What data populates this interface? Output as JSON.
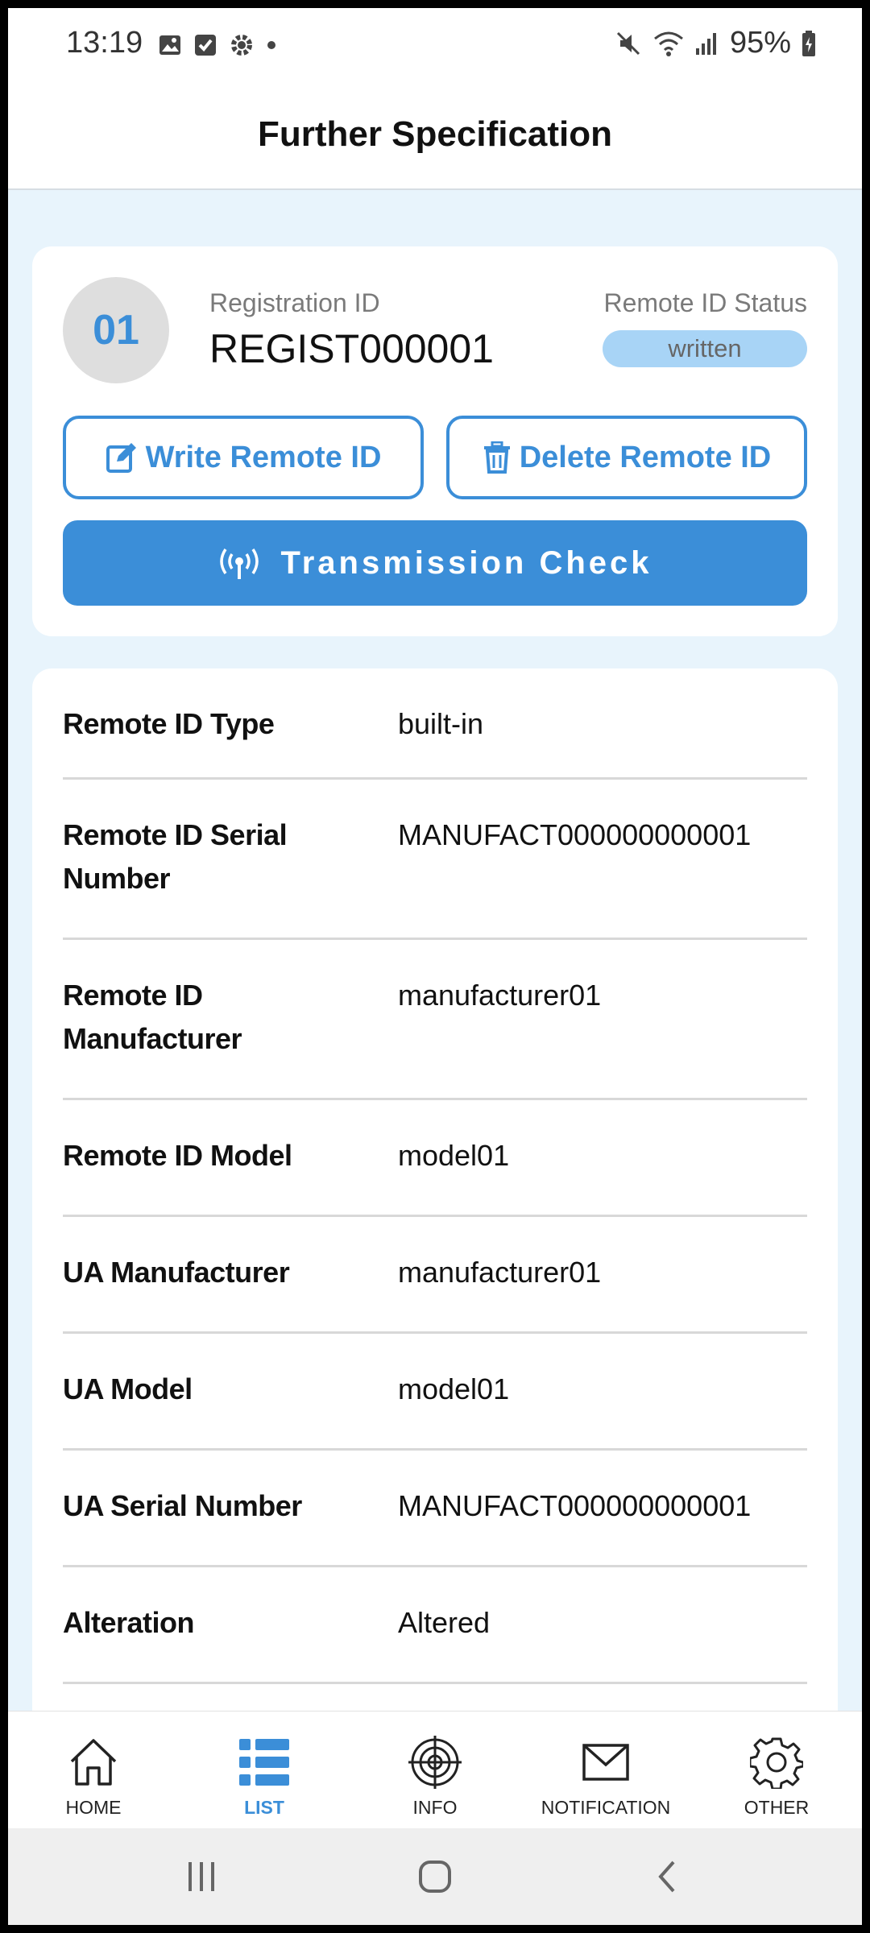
{
  "status_bar": {
    "time": "13:19",
    "battery": "95%"
  },
  "header": {
    "title": "Further Specification"
  },
  "registration": {
    "number": "01",
    "id_label": "Registration ID",
    "id_value": "REGIST000001",
    "status_label": "Remote ID Status",
    "status_value": "written"
  },
  "actions": {
    "write_label": "Write Remote ID",
    "delete_label": "Delete Remote ID",
    "transmission_label": "Transmission Check"
  },
  "specs": [
    {
      "label": "Remote ID Type",
      "value": "built-in"
    },
    {
      "label": "Remote ID Serial Number",
      "value": "MANUFACT000000000001"
    },
    {
      "label": "Remote ID Manufacturer",
      "value": "manufacturer01"
    },
    {
      "label": "Remote ID Model",
      "value": "model01"
    },
    {
      "label": "UA Manufacturer",
      "value": "manufacturer01"
    },
    {
      "label": "UA Model",
      "value": "model01"
    },
    {
      "label": "UA Serial Number",
      "value": "MANUFACT000000000001"
    },
    {
      "label": "Alteration",
      "value": "Altered"
    }
  ],
  "bottom_nav": [
    {
      "label": "HOME",
      "icon": "home-icon",
      "active": false
    },
    {
      "label": "LIST",
      "icon": "list-icon",
      "active": true
    },
    {
      "label": "INFO",
      "icon": "target-icon",
      "active": false
    },
    {
      "label": "NOTIFICATION",
      "icon": "envelope-icon",
      "active": false
    },
    {
      "label": "OTHER",
      "icon": "gear-icon",
      "active": false
    }
  ],
  "colors": {
    "accent": "#3b8ed8",
    "background": "#e8f4fc",
    "badge": "#a8d4f6"
  }
}
